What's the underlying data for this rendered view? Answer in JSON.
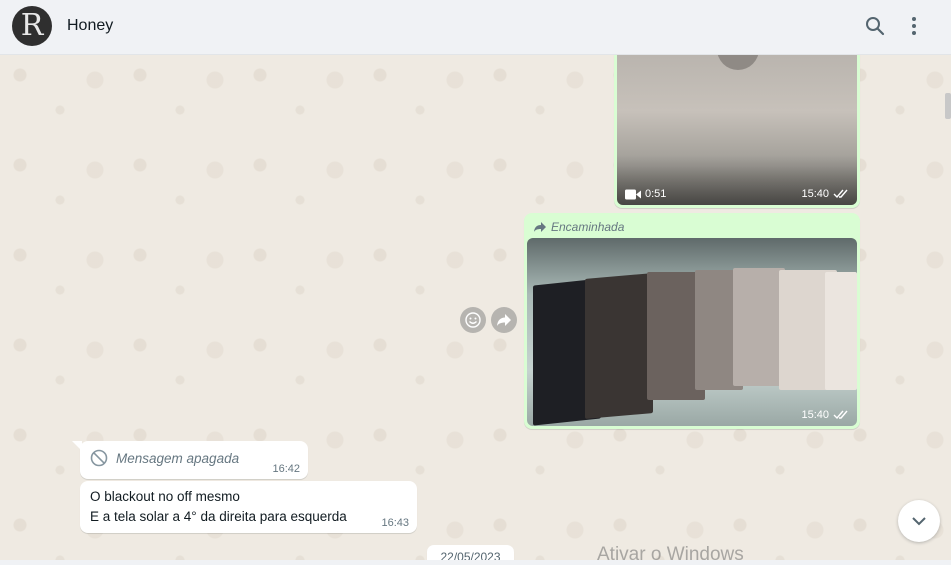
{
  "header": {
    "avatar_letter": "R",
    "contact_name": "Honey",
    "search_icon": "search-icon",
    "menu_icon": "kebab-menu-icon"
  },
  "messages": {
    "video": {
      "duration": "0:51",
      "time": "15:40",
      "status_icon": "double-check-icon"
    },
    "image": {
      "forwarded_label": "Encaminhada",
      "time": "15:40",
      "status_icon": "double-check-icon"
    },
    "deleted": {
      "text": "Mensagem apagada",
      "time": "16:42"
    },
    "text": {
      "line1": "O blackout no off mesmo",
      "line2": "E a tela solar a 4° da direita para esquerda",
      "time": "16:43"
    }
  },
  "date_chip": "22/05/2023",
  "watermark": "Ativar o Windows",
  "colors": {
    "outgoing_bubble": "#d9fdd3",
    "incoming_bubble": "#ffffff",
    "chat_background": "#efeae2",
    "header_background": "#f0f2f5"
  }
}
